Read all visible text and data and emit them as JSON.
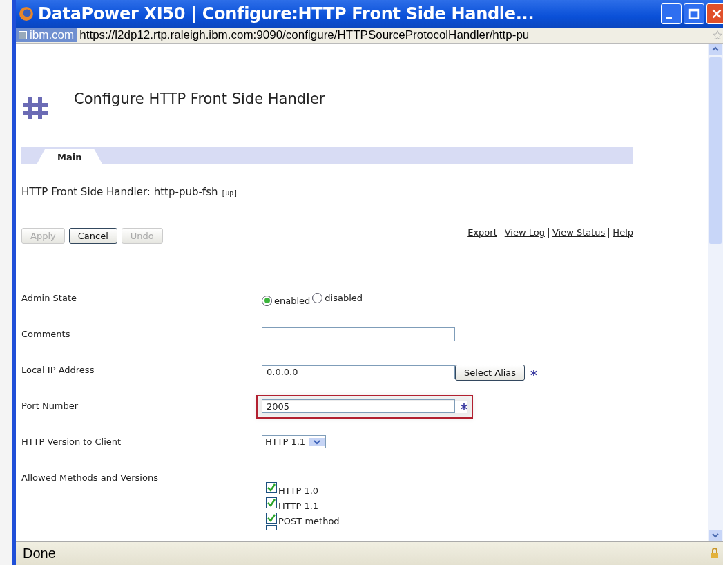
{
  "window": {
    "title": "DataPower XI50 | Configure:HTTP Front Side Handle..."
  },
  "address_bar": {
    "site": "ibm.com",
    "url": "https://l2dp12.rtp.raleigh.ibm.com:9090/configure/HTTPSourceProtocolHandler/http-pu"
  },
  "page": {
    "heading": "Configure HTTP Front Side Handler",
    "tabs": [
      {
        "label": "Main",
        "selected": true
      }
    ],
    "object_title": "HTTP Front Side Handler: http-pub-fsh",
    "object_status": "[up]",
    "buttons": [
      {
        "label": "Apply",
        "disabled": true
      },
      {
        "label": "Cancel",
        "disabled": false
      },
      {
        "label": "Undo",
        "disabled": true
      }
    ],
    "links": [
      "Export",
      "View Log",
      "View Status",
      "Help"
    ],
    "fields": [
      {
        "kind": "radio",
        "label": "Admin State",
        "options": [
          {
            "label": "enabled",
            "selected": true
          },
          {
            "label": "disabled",
            "selected": false
          }
        ]
      },
      {
        "kind": "text",
        "label": "Comments",
        "required": false,
        "highlighted": false
      },
      {
        "kind": "text",
        "label": "Local IP Address",
        "value": "0.0.0.0",
        "button": "Select Alias",
        "required": true,
        "highlighted": false
      },
      {
        "kind": "text",
        "label": "Port Number",
        "value": "2005",
        "required": true,
        "highlighted": true
      },
      {
        "kind": "select",
        "label": "HTTP Version to Client",
        "value": "HTTP 1.1"
      },
      {
        "kind": "checks",
        "label": "Allowed Methods and Versions",
        "options": [
          {
            "label": "HTTP 1.0",
            "checked": true
          },
          {
            "label": "HTTP 1.1",
            "checked": true
          },
          {
            "label": "POST method",
            "checked": true
          }
        ],
        "partial_option": {
          "checked": false
        }
      }
    ]
  },
  "status_bar": {
    "text": "Done"
  }
}
